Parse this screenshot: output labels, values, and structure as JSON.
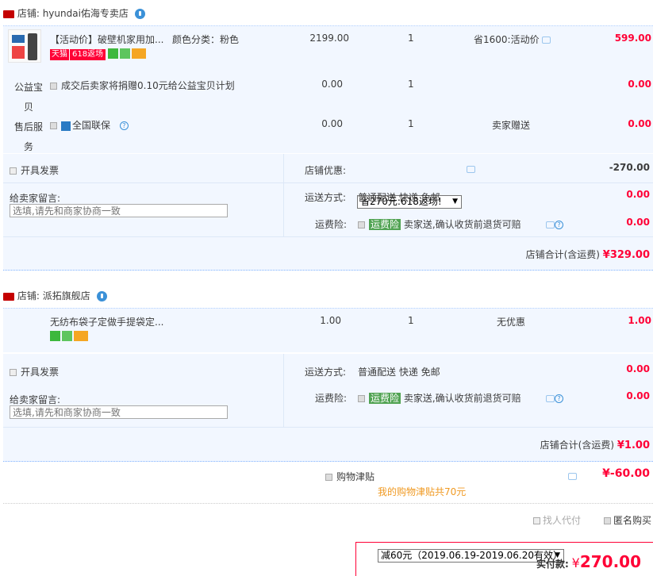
{
  "shop1": {
    "name_prefix": "店铺:",
    "name": "hyundai佑海专卖店",
    "item": {
      "title": "【活动价】破壁机家用加...",
      "spec": "颜色分类：粉色",
      "tag_tmall": "天猫",
      "tag_618": "618返场",
      "price": "2199.00",
      "qty": "1",
      "promo": "省1600:活动价",
      "subtotal": "599.00"
    },
    "charity": {
      "label": "公益宝贝",
      "text": "成交后卖家将捐赠0.10元给公益宝贝计划",
      "price": "0.00",
      "qty": "1",
      "subtotal": "0.00"
    },
    "service": {
      "label": "售后服务",
      "text": "全国联保",
      "price": "0.00",
      "qty": "1",
      "promo": "卖家赠送",
      "subtotal": "0.00"
    },
    "invoice_label": "开具发票",
    "discount_label": "店铺优惠:",
    "discount_select": "省270元:618返场!",
    "discount_value": "-270.00",
    "message_label": "给卖家留言:",
    "message_placeholder": "选填,请先和商家协商一致",
    "shipping_label": "运送方式:",
    "shipping_value": "普通配送 快递 免邮",
    "shipping_fee": "0.00",
    "insurance_label": "运费险:",
    "insurance_tag": "运费险",
    "insurance_text": "卖家送,确认收货前退货可赔",
    "insurance_fee": "0.00",
    "total_label": "店铺合计(含运费)",
    "total_value": "¥329.00"
  },
  "shop2": {
    "name_prefix": "店铺:",
    "name": "派拓旗舰店",
    "item": {
      "title": "无纺布袋子定做手提袋定...",
      "price": "1.00",
      "qty": "1",
      "promo": "无优惠",
      "subtotal": "1.00"
    },
    "invoice_label": "开具发票",
    "message_label": "给卖家留言:",
    "message_placeholder": "选填,请先和商家协商一致",
    "shipping_label": "运送方式:",
    "shipping_value": "普通配送 快递 免邮",
    "shipping_fee": "0.00",
    "insurance_label": "运费险:",
    "insurance_tag": "运费险",
    "insurance_text": "卖家送,确认收货前退货可赔",
    "insurance_fee": "0.00",
    "total_label": "店铺合计(含运费)",
    "total_value": "¥1.00"
  },
  "allowance": {
    "label": "购物津贴",
    "select": "减60元（2019.06.19-2019.06.20有效）",
    "value": "¥-60.00",
    "note": "我的购物津贴共70元"
  },
  "options": {
    "proxy_pay": "找人代付",
    "anonymous": "匿名购买"
  },
  "pay": {
    "label": "实付款:",
    "currency": "¥",
    "amount": "270.00"
  },
  "colors": {
    "accent": "#ff0036",
    "blue_bg": "#f2f7ff",
    "link": "#3b91d8",
    "note": "#f09a23"
  }
}
